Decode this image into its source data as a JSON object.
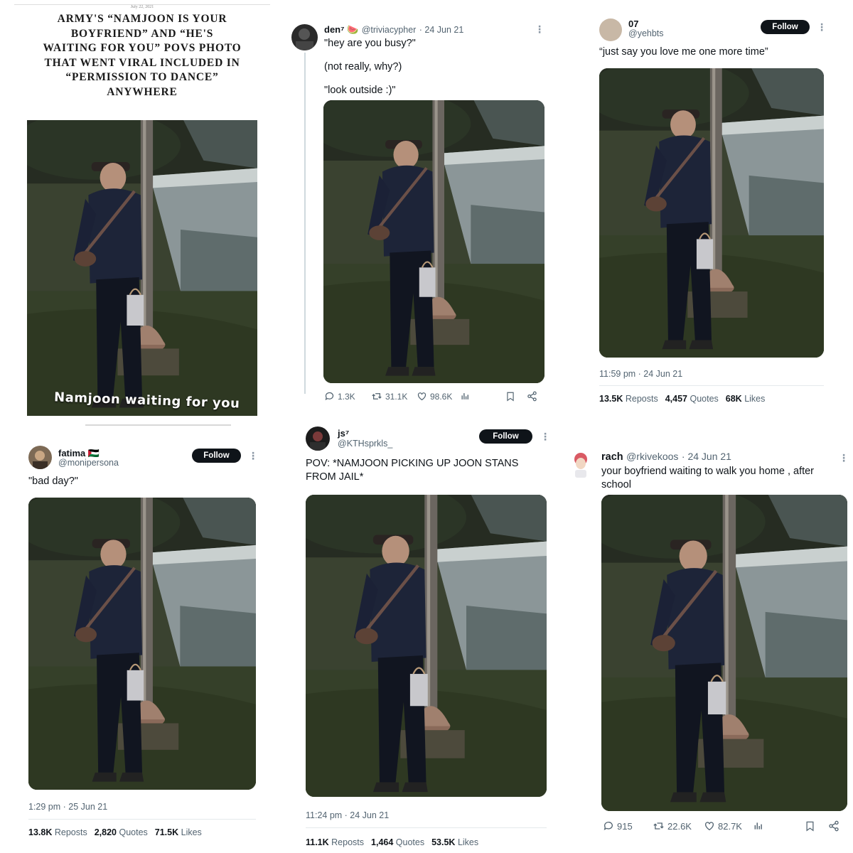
{
  "article": {
    "date": "July 22, 2021",
    "title": "ARMY'S “NAMJOON IS YOUR BOYFRIEND” AND “HE'S WAITING FOR YOU” POVS PHOTO THAT WENT VIRAL INCLUDED IN “PERMISSION TO DANCE” ANYWHERE",
    "overlay_caption": "Namjoon waiting for you"
  },
  "tweets": [
    {
      "name": "den⁷ 🍉",
      "handle": "@triviacypher",
      "date": "· 24 Jun 21",
      "lines": [
        "\"hey are you busy?\"",
        "(not really, why?)",
        "\"look outside :)\""
      ],
      "replies": "1.3K",
      "retweets": "31.1K",
      "likes": "98.6K"
    },
    {
      "name": "07",
      "handle": "@yehbts",
      "follow": "Follow",
      "text": "“just say you love me one more time”",
      "time": "11:59 pm · 24 Jun 21",
      "reposts": "13.5K",
      "quotes": "4,457",
      "likes": "68K",
      "reposts_label": "Reposts",
      "quotes_label": "Quotes",
      "likes_label": "Likes"
    },
    {
      "name": "fatima 🇵🇸",
      "handle": "@monipersona",
      "follow": "Follow",
      "text": "\"bad day?\"",
      "time": "1:29 pm · 25 Jun 21",
      "reposts": "13.8K",
      "quotes": "2,820",
      "likes": "71.5K",
      "reposts_label": "Reposts",
      "quotes_label": "Quotes",
      "likes_label": "Likes"
    },
    {
      "name": "js⁷",
      "handle": "@KTHsprkls_",
      "follow": "Follow",
      "text": "POV: *NAMJOON PICKING UP JOON STANS FROM JAIL*",
      "time": "11:24 pm · 24 Jun 21",
      "reposts": "11.1K",
      "quotes": "1,464",
      "likes": "53.5K",
      "reposts_label": "Reposts",
      "quotes_label": "Quotes",
      "likes_label": "Likes"
    },
    {
      "name": "rach",
      "handle": "@rkivekoos",
      "date": "· 24 Jun 21",
      "text": "your boyfriend waiting to walk you home , after school",
      "replies": "915",
      "retweets": "22.6K",
      "likes": "82.7K"
    }
  ],
  "colors": {
    "text": "#0f1419",
    "secondary": "#536471",
    "button": "#0f1419",
    "photo_grass": "#3a4230"
  },
  "icons": [
    "reply-icon",
    "retweet-icon",
    "like-icon",
    "analytics-icon",
    "bookmark-icon",
    "share-icon",
    "more-icon"
  ]
}
